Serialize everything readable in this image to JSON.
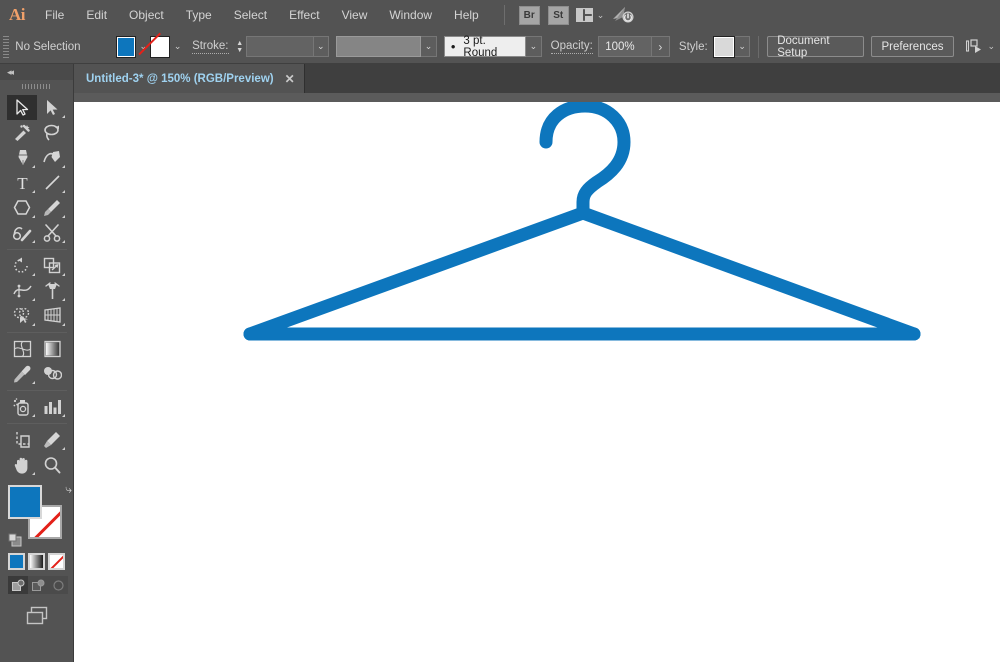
{
  "app": {
    "name": "Adobe Illustrator",
    "logo_text": "Ai"
  },
  "menubar": {
    "items": [
      {
        "label": "File"
      },
      {
        "label": "Edit"
      },
      {
        "label": "Object"
      },
      {
        "label": "Type"
      },
      {
        "label": "Select"
      },
      {
        "label": "Effect"
      },
      {
        "label": "View"
      },
      {
        "label": "Window"
      },
      {
        "label": "Help"
      }
    ],
    "bridge_label": "Br",
    "stock_label": "St",
    "arrange_icon": "arrange-documents-icon",
    "arrange_chevron": "⌄",
    "publish_icon": "publish-online-icon"
  },
  "control_bar": {
    "selection_status": "No Selection",
    "fill_swatch": {
      "name": "fill-color",
      "color": "#0d76bd"
    },
    "stroke_swatch": {
      "name": "stroke-color",
      "color": "none"
    },
    "stroke_label": "Stroke:",
    "stroke_weight_value": "",
    "brush_definition": "3 pt. Round",
    "brush_bullet": "•",
    "opacity_label": "Opacity:",
    "opacity_value": "100%",
    "opacity_arrow": "›",
    "style_label": "Style:",
    "style_swatch_color": "#d9d9d9",
    "document_setup_label": "Document Setup",
    "preferences_label": "Preferences",
    "align_icon": "align-to-artboard-icon",
    "align_chevron": "⌄",
    "dropdown_chevron": "⌄",
    "stepper_up": "▲",
    "stepper_down": "▼"
  },
  "tab_bar": {
    "document_tab": {
      "title": "Untitled-3* @ 150% (RGB/Preview)",
      "close": "✕"
    }
  },
  "toolbar": {
    "collapse_icon": "◂◂",
    "tools": [
      {
        "name": "selection-tool",
        "label": "Selection Tool",
        "active": true,
        "has_flyout": false
      },
      {
        "name": "direct-selection-tool",
        "label": "Direct Selection Tool",
        "active": false,
        "has_flyout": true
      },
      {
        "name": "magic-wand-tool",
        "label": "Magic Wand Tool",
        "active": false,
        "has_flyout": false
      },
      {
        "name": "lasso-tool",
        "label": "Lasso Tool",
        "active": false,
        "has_flyout": false
      },
      {
        "name": "pen-tool",
        "label": "Pen Tool",
        "active": false,
        "has_flyout": true
      },
      {
        "name": "curvature-tool",
        "label": "Curvature Tool",
        "active": false,
        "has_flyout": true
      },
      {
        "name": "type-tool",
        "label": "Type Tool",
        "active": false,
        "has_flyout": true
      },
      {
        "name": "line-segment-tool",
        "label": "Line Segment Tool",
        "active": false,
        "has_flyout": true
      },
      {
        "name": "rectangle-tool",
        "label": "Rectangle Tool",
        "active": false,
        "has_flyout": true
      },
      {
        "name": "paintbrush-tool",
        "label": "Paintbrush Tool",
        "active": false,
        "has_flyout": true
      },
      {
        "name": "shaper-tool",
        "label": "Shaper Tool",
        "active": false,
        "has_flyout": true
      },
      {
        "name": "scissors-tool",
        "label": "Scissors Tool",
        "active": false,
        "has_flyout": true
      },
      {
        "name": "rotate-tool",
        "label": "Rotate Tool",
        "active": false,
        "has_flyout": true
      },
      {
        "name": "scale-tool",
        "label": "Scale Tool",
        "active": false,
        "has_flyout": true
      },
      {
        "name": "width-tool",
        "label": "Width Tool",
        "active": false,
        "has_flyout": true
      },
      {
        "name": "free-transform-tool",
        "label": "Free Transform Tool",
        "active": false,
        "has_flyout": true
      },
      {
        "name": "shape-builder-tool",
        "label": "Shape Builder Tool",
        "active": false,
        "has_flyout": true
      },
      {
        "name": "perspective-grid-tool",
        "label": "Perspective Grid Tool",
        "active": false,
        "has_flyout": true
      },
      {
        "name": "mesh-tool",
        "label": "Mesh Tool",
        "active": false,
        "has_flyout": false
      },
      {
        "name": "gradient-tool",
        "label": "Gradient Tool",
        "active": false,
        "has_flyout": false
      },
      {
        "name": "eyedropper-tool",
        "label": "Eyedropper Tool",
        "active": false,
        "has_flyout": true
      },
      {
        "name": "blend-tool",
        "label": "Blend Tool",
        "active": false,
        "has_flyout": false
      },
      {
        "name": "symbol-sprayer-tool",
        "label": "Symbol Sprayer Tool",
        "active": false,
        "has_flyout": true
      },
      {
        "name": "column-graph-tool",
        "label": "Column Graph Tool",
        "active": false,
        "has_flyout": true
      },
      {
        "name": "artboard-tool",
        "label": "Artboard Tool",
        "active": false,
        "has_flyout": false
      },
      {
        "name": "slice-tool",
        "label": "Slice Tool",
        "active": false,
        "has_flyout": true
      },
      {
        "name": "hand-tool",
        "label": "Hand Tool",
        "active": false,
        "has_flyout": true
      },
      {
        "name": "zoom-tool",
        "label": "Zoom Tool",
        "active": false,
        "has_flyout": false
      }
    ],
    "fill_color": "#0d76bd",
    "stroke_color": "none",
    "swap_icon": "⤷",
    "color_mode_buttons": [
      {
        "name": "color-button",
        "label": "Color"
      },
      {
        "name": "gradient-button",
        "label": "Gradient"
      },
      {
        "name": "none-button",
        "label": "None"
      }
    ],
    "draw_modes": [
      {
        "name": "draw-normal-button",
        "label": "Draw Normal",
        "active": true
      },
      {
        "name": "draw-behind-button",
        "label": "Draw Behind",
        "active": false
      },
      {
        "name": "draw-inside-button",
        "label": "Draw Inside",
        "active": false
      }
    ],
    "screen_mode": {
      "name": "change-screen-mode-button",
      "label": "Change Screen Mode"
    }
  },
  "canvas": {
    "artboard_background": "#ffffff",
    "pasteboard_background": "#5b5b5b",
    "artwork": {
      "name": "clothes-hanger",
      "description": "Blue clothes hanger vector illustration",
      "color": "#0d76bd"
    }
  }
}
